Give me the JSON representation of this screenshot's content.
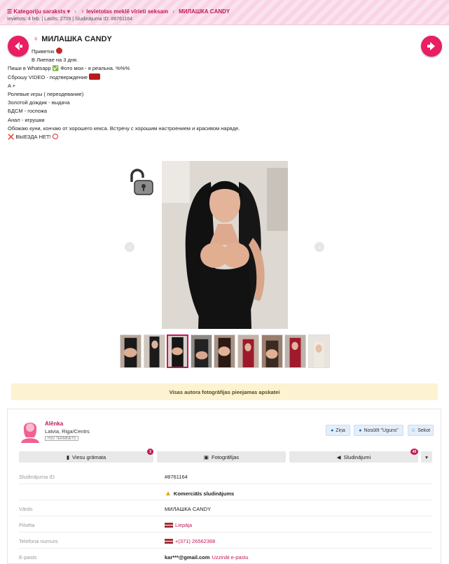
{
  "breadcrumb": {
    "categories": "☰ Kategoriju saraksts ▾",
    "section": "♀ Ievietotas meklē vīrieti seksam",
    "current": "МИЛАШКА CANDY"
  },
  "meta": "Ievietots: 4 feb. | Lasīts: 2709 | Sludinājuma ID: #8761164",
  "title": "МИЛАШКА CANDY",
  "description": [
    "Приветик",
    "В Лиепае на 3 дня.",
    "Пиши в Whatsapp ✅ Фото мои - я реальна. %%%",
    "Сброшу VIDEO - подтверждение",
    "A +",
    "Ролевые игры ( переодевание)",
    "Золотой дождик - выдача",
    "БДСМ - госпожа",
    "Анал - игрушки",
    "Обожаю куни, кончаю от хорошего кекса. Встречу с хорошим настроением и красивом наряде.",
    "❌ ВЫЕЗДА НЕТ!"
  ],
  "notice": "Visas autora fotogrāfijas pieejamas apskatei",
  "author": {
    "name": "Alēnka",
    "location": "Latvia, Riga/Centrs",
    "badge": "HSV TERMINĒTS"
  },
  "buttons": {
    "message": "Ziņa",
    "fire": "Nosūtīt \"Uguns\"",
    "follow": "Sekot"
  },
  "tabs": {
    "guestbook": "Viesu grāmata",
    "guestbook_count": "3",
    "photos": "Fotogrāfijas",
    "ads": "Sludinājumi",
    "ads_count": "40"
  },
  "details": [
    {
      "key": "Sludinājuma ID",
      "value": "#8761164"
    },
    {
      "key": "",
      "value": "Komerciāls sludinājums"
    },
    {
      "key": "Vārds",
      "value": "МИЛАШКА CANDY"
    },
    {
      "key": "Pilsēta",
      "value": "Liepāja"
    },
    {
      "key": "Telefona numurs",
      "value": "+(371) 26562368"
    },
    {
      "key": "E-pasts",
      "value": "kar***@gmail.com",
      "link": "Uzzināt e-pastu"
    }
  ],
  "colors": {
    "accent": "#e91e63",
    "accent_dark": "#c2185b",
    "notice_bg": "#fdf3d2"
  }
}
